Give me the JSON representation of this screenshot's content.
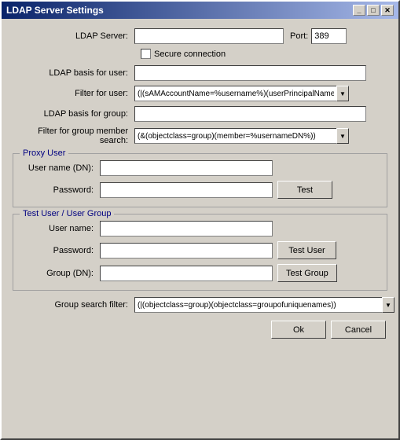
{
  "window": {
    "title": "LDAP Server Settings",
    "close_btn": "✕",
    "minimize_btn": "_",
    "maximize_btn": "□"
  },
  "form": {
    "ldap_server_label": "LDAP Server:",
    "ldap_server_value": "",
    "port_label": "Port:",
    "port_value": "389",
    "secure_label": "Secure connection",
    "ldap_basis_user_label": "LDAP basis for user:",
    "ldap_basis_user_value": "",
    "filter_user_label": "Filter for user:",
    "filter_user_value": "(|(sAMAccountName=%username%)(userPrincipalName=%",
    "ldap_basis_group_label": "LDAP basis for group:",
    "ldap_basis_group_value": "",
    "filter_group_label": "Filter for group member search:",
    "filter_group_value": "(&(objectclass=group)(member=%usernameDN%))",
    "proxy_user_section": "Proxy User",
    "proxy_username_label": "User name (DN):",
    "proxy_username_value": "",
    "proxy_password_label": "Password:",
    "proxy_password_value": "",
    "test_btn": "Test",
    "test_user_section": "Test User / User Group",
    "test_username_label": "User name:",
    "test_username_value": "",
    "test_password_label": "Password:",
    "test_password_value": "",
    "test_user_btn": "Test User",
    "test_group_label": "Group (DN):",
    "test_group_value": "",
    "test_group_btn": "Test Group",
    "group_search_filter_label": "Group search filter:",
    "group_search_filter_value": "(|(objectclass=group)(objectclass=groupofuniquenames))",
    "ok_btn": "Ok",
    "cancel_btn": "Cancel"
  }
}
